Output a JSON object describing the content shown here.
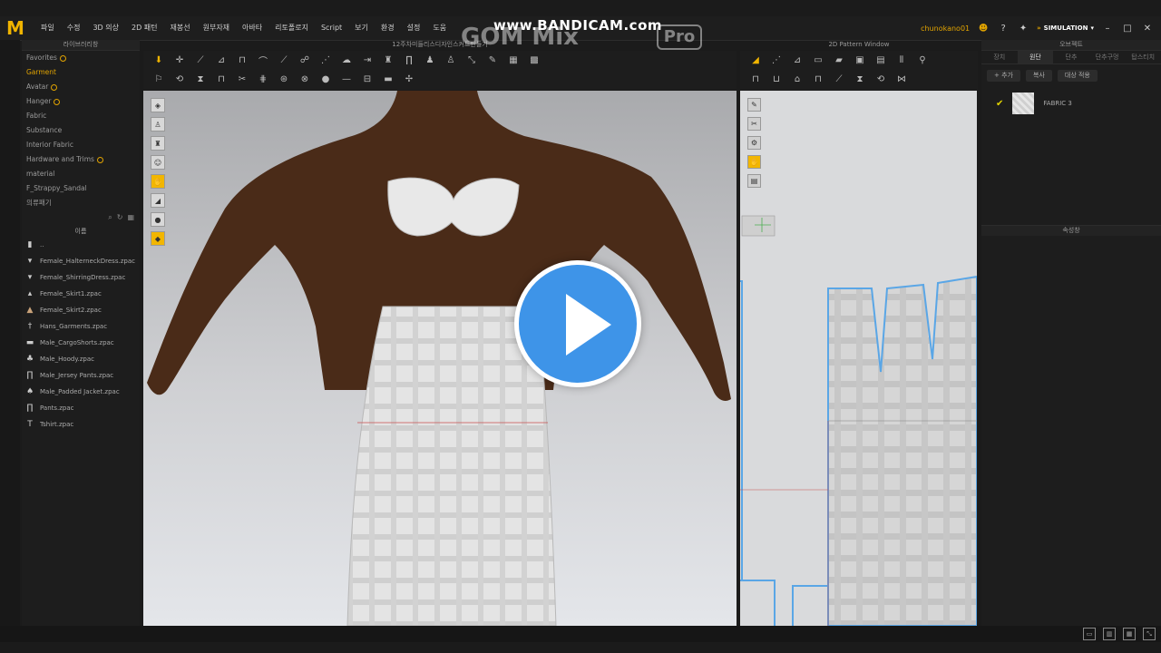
{
  "app": {
    "logo_text": "M",
    "menus": [
      "파일",
      "수정",
      "3D 의상",
      "2D 패턴",
      "재봉선",
      "원부자재",
      "아바타",
      "리토폴로지",
      "Script",
      "보기",
      "환경",
      "설정",
      "도움"
    ],
    "username": "chunokano01",
    "mode_label": "SIMULATION"
  },
  "watermark": {
    "url": "www.BANDICAM.com",
    "brand": "GOM Mix",
    "pro": "Pro"
  },
  "library": {
    "title": "라이브러리창",
    "items": [
      {
        "label": "Favorites",
        "active": false,
        "dot": true
      },
      {
        "label": "Garment",
        "active": true,
        "dot": false
      },
      {
        "label": "Avatar",
        "active": false,
        "dot": true
      },
      {
        "label": "Hanger",
        "active": false,
        "dot": true
      },
      {
        "label": "Fabric",
        "active": false,
        "dot": false
      },
      {
        "label": "Substance",
        "active": false,
        "dot": false
      },
      {
        "label": "Interior Fabric",
        "active": false,
        "dot": false
      },
      {
        "label": "Hardware and Trims",
        "active": false,
        "dot": true
      },
      {
        "label": "material",
        "active": false,
        "dot": false
      },
      {
        "label": "F_Strappy_Sandal",
        "active": false,
        "dot": false
      },
      {
        "label": "의류패기",
        "active": false,
        "dot": false
      }
    ],
    "column_header": "이름",
    "files": [
      {
        "name": "..",
        "icon": "folder-up"
      },
      {
        "name": "Female_HalterneckDress.zpac",
        "icon": "dress"
      },
      {
        "name": "Female_ShirringDress.zpac",
        "icon": "dress"
      },
      {
        "name": "Female_Skirt1.zpac",
        "icon": "skirt"
      },
      {
        "name": "Female_Skirt2.zpac",
        "icon": "skirt"
      },
      {
        "name": "Hans_Garments.zpac",
        "icon": "hanger"
      },
      {
        "name": "Male_CargoShorts.zpac",
        "icon": "shorts"
      },
      {
        "name": "Male_Hoody.zpac",
        "icon": "hoody"
      },
      {
        "name": "Male_Jersey Pants.zpac",
        "icon": "pants"
      },
      {
        "name": "Male_Padded Jacket.zpac",
        "icon": "jacket"
      },
      {
        "name": "Pants.zpac",
        "icon": "pants"
      },
      {
        "name": "Tshirt.zpac",
        "icon": "tshirt"
      }
    ]
  },
  "viewport3d": {
    "title": "12주차미들리스디자인스커트만들기"
  },
  "pattern2d": {
    "title": "2D Pattern Window"
  },
  "right_panel": {
    "header": "오브젝트",
    "tabs": [
      "장치",
      "원단",
      "단추",
      "단추구멍",
      "탑스티치"
    ],
    "active_tab": 1,
    "toolbar": [
      "+ 추가",
      "복사",
      "대상 적용"
    ],
    "fabric_name": "FABRIC 3",
    "properties_header": "속성창"
  },
  "colors": {
    "accent": "#e2a400",
    "play": "#3e94e8",
    "pattern_outline": "#5aa6e6"
  }
}
